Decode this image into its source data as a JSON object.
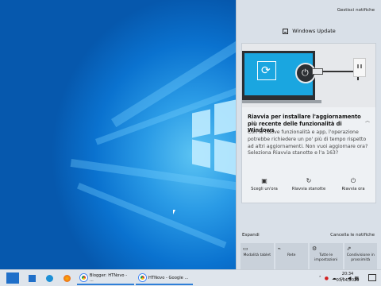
{
  "action_center": {
    "manage_notifications": "Gestisci notifiche",
    "group_header": "Windows Update",
    "notification": {
      "title": "Riavvia per installare l'aggiornamento più recente delle funzionalità di Windows",
      "body": "Con le nuove funzionalità e app, l'operazione potrebbe richiedere un po' più di tempo rispetto ad altri aggiornamenti. Non vuoi aggiornare ora? Seleziona Riavvia stanotte e l'a 163?",
      "actions": [
        {
          "icon": "calendar-clock-icon",
          "label": "Scegli un'ora"
        },
        {
          "icon": "moon-restart-icon",
          "label": "Riavvia stanotte"
        },
        {
          "icon": "power-icon",
          "label": "Riavvia ora"
        }
      ]
    },
    "expand": "Espandi",
    "clear_all": "Cancella le notifiche",
    "quick_actions": [
      {
        "icon": "tablet-mode-icon",
        "label": "Modalità tablet"
      },
      {
        "icon": "network-icon",
        "label": "Rete"
      },
      {
        "icon": "settings-icon",
        "label": "Tutte le impostazioni"
      },
      {
        "icon": "nearby-sharing-icon",
        "label": "Condivisione in prossimità"
      }
    ]
  },
  "taskbar": {
    "tasks": [
      {
        "icon": "chrome-icon",
        "label": "Blogger: HTNovo - ..."
      },
      {
        "icon": "chrome-icon",
        "label": "HTNovo - Google ..."
      }
    ],
    "clock_time": "20:34",
    "clock_date": "03/04/2020"
  },
  "colors": {
    "accent": "#2f7fd8",
    "panel": "#d9e0e8",
    "wallpaper": "#0a72cf"
  }
}
